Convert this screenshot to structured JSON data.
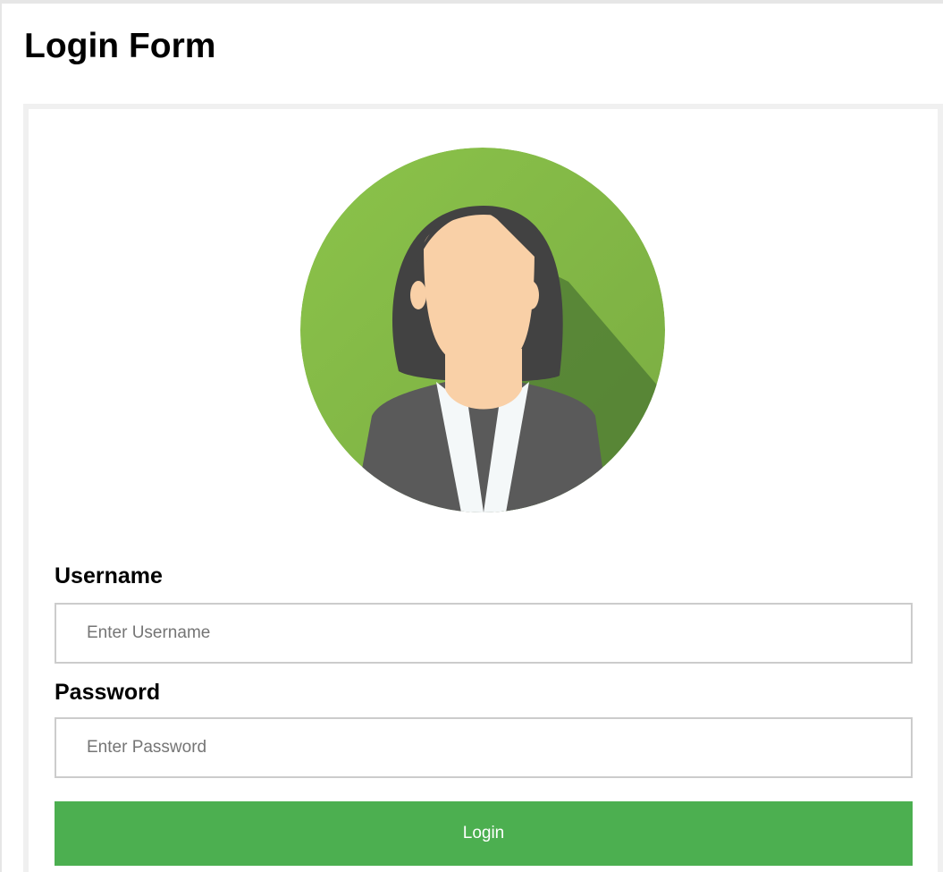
{
  "page": {
    "title": "Login Form"
  },
  "form": {
    "avatar_icon": "female-user-avatar-icon",
    "username": {
      "label": "Username",
      "placeholder": "Enter Username",
      "value": ""
    },
    "password": {
      "label": "Password",
      "placeholder": "Enter Password",
      "value": ""
    },
    "submit_label": "Login"
  },
  "colors": {
    "accent": "#4caf50",
    "avatar_background": "#8bc34a",
    "avatar_shadow": "#548235",
    "hair": "#424242",
    "skin": "#f9d0a7",
    "jacket": "#5a5a5a",
    "shirt": "#f4f8f9"
  }
}
